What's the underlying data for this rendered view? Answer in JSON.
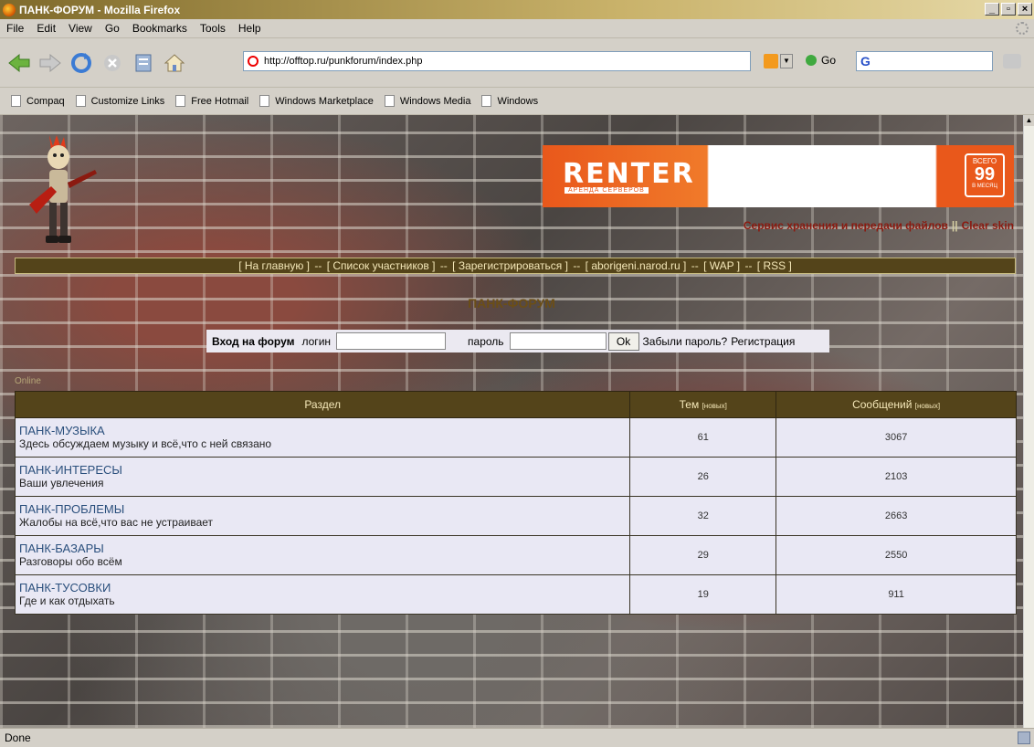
{
  "window": {
    "title": "ПАНК-ФОРУМ - Mozilla Firefox",
    "min": "_",
    "max": "▫",
    "close": "×"
  },
  "menu": [
    "File",
    "Edit",
    "View",
    "Go",
    "Bookmarks",
    "Tools",
    "Help"
  ],
  "address": {
    "url": "http://offtop.ru/punkforum/index.php",
    "go": "Go",
    "search": "G"
  },
  "bookmarks": [
    "Compaq",
    "Customize Links",
    "Free Hotmail",
    "Windows Marketplace",
    "Windows Media",
    "Windows"
  ],
  "banner": {
    "logo": "RENTER",
    "sub": "АРЕНДА СЕРВЕРОВ",
    "price_top": "ВСЕГО",
    "price": "99",
    "price_bottom": "В МЕСЯЦ"
  },
  "service": {
    "link1": "Сервис хранения и передачи файлов",
    "sep": "||",
    "link2": "Clear skin"
  },
  "nav": {
    "home": "[ На главную ]",
    "members": "[ Список участников ]",
    "register": "[ Зарегистрироваться ]",
    "aborigeni": "[ aborigeni.narod.ru ]",
    "wap": "[ WAP ]",
    "rss": "[ RSS ]",
    "dash": "--"
  },
  "forum_title": "ПАНК-ФОРУМ",
  "login": {
    "heading": "Вход на форум",
    "login_label": "логин",
    "password_label": "пароль",
    "ok": "Ok",
    "forgot": "Забыли пароль?",
    "register": "Регистрация"
  },
  "online": "Online",
  "table": {
    "col_section": "Раздел",
    "col_topics": "Тем",
    "col_messages": "Сообщений",
    "new_label": "[новых]",
    "rows": [
      {
        "name": "ПАНК-МУЗЫКА",
        "desc": "Здесь обсуждаем музыку и всё,что с ней связано",
        "topics": "61",
        "messages": "3067"
      },
      {
        "name": "ПАНК-ИНТЕРЕСЫ",
        "desc": "Ваши увлечения",
        "topics": "26",
        "messages": "2103"
      },
      {
        "name": "ПАНК-ПРОБЛЕМЫ",
        "desc": "Жалобы на всё,что вас не устраивает",
        "topics": "32",
        "messages": "2663"
      },
      {
        "name": "ПАНК-БАЗАРЫ",
        "desc": "Разговоры обо всём",
        "topics": "29",
        "messages": "2550"
      },
      {
        "name": "ПАНК-ТУСОВКИ",
        "desc": "Где и как отдыхать",
        "topics": "19",
        "messages": "911"
      }
    ]
  },
  "status": "Done",
  "colors": {
    "header_bg": "#54441a",
    "header_text": "#f4e7b8",
    "cell_bg": "#e9e8f4",
    "link": "#2a4f7c",
    "service": "#8b1a10"
  }
}
